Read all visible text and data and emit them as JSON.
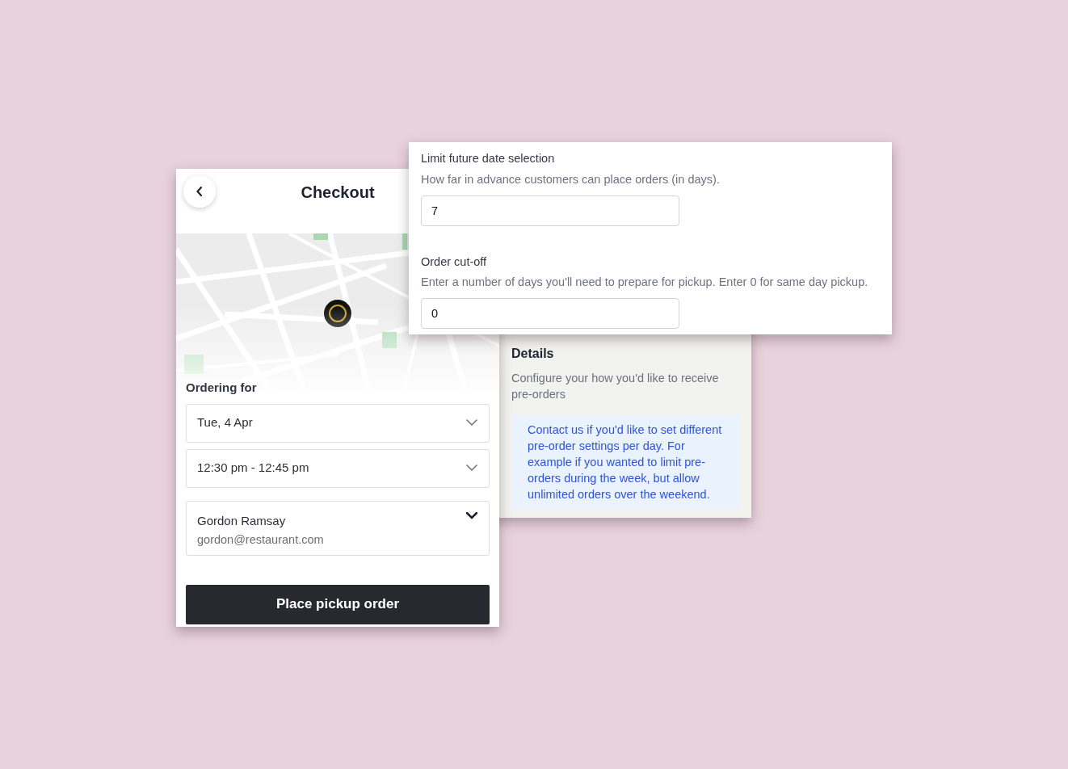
{
  "checkout": {
    "title": "Checkout",
    "section_label": "Ordering for",
    "selects": [
      {
        "kind": "select",
        "value": "Tue, 4 Apr"
      },
      {
        "kind": "select",
        "value": "12:30 pm - 12:45 pm"
      },
      {
        "kind": "contact",
        "name": "Gordon Ramsay",
        "email": "gordon@restaurant.com"
      }
    ],
    "submit": "Place pickup order"
  },
  "settings": {
    "fields": [
      {
        "label": "Limit future date selection",
        "help": "How far in advance customers can place orders (in days).",
        "value": "7"
      },
      {
        "label": "Order cut-off",
        "help": "Enter a number of days you'll need to prepare for pickup. Enter 0 for same day pickup.",
        "value": "0"
      }
    ]
  },
  "details": {
    "title": "Details",
    "description": "Configure your how you'd like to receive pre-orders",
    "note": "Contact us if you'd like to set different pre-order settings per day. For example if you wanted to limit pre-orders during the week, but allow unlimited orders over the weekend."
  }
}
